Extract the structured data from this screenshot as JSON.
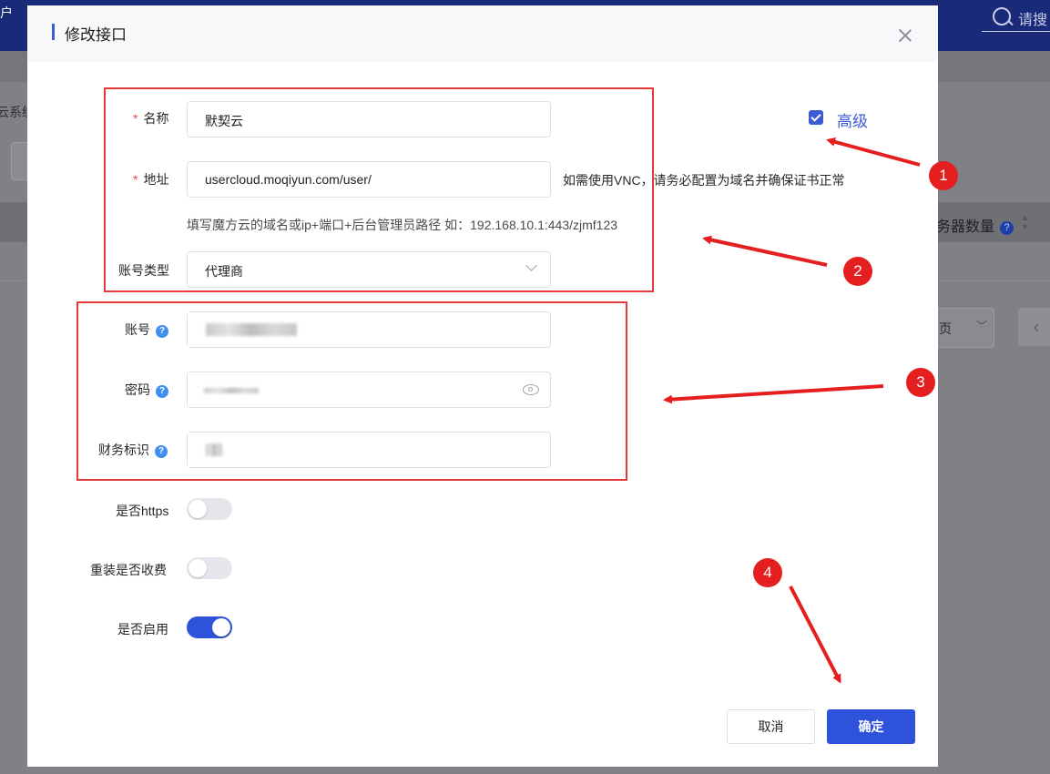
{
  "background": {
    "corner_text": "户",
    "search_placeholder": "请搜",
    "left_label": "云系统",
    "server_count_header": "务器数量",
    "server_count_help": "?",
    "page_selector": "页",
    "prev_glyph": "‹"
  },
  "dialog": {
    "title": "修改接口",
    "advanced_label": "高级",
    "advanced_checked": true,
    "fields": {
      "name": {
        "label": "名称",
        "required": true,
        "value": "默契云"
      },
      "address": {
        "label": "地址",
        "required": true,
        "value": "usercloud.moqiyun.com/user/",
        "side_hint": "如需使用VNC，请务必配置为域名并确保证书正常",
        "hint": "填写魔方云的域名或ip+端口+后台管理员路径 如：192.168.10.1:443/zjmf123"
      },
      "account_type": {
        "label": "账号类型",
        "value": "代理商"
      },
      "account": {
        "label": "账号"
      },
      "password": {
        "label": "密码"
      },
      "finance_id": {
        "label": "财务标识"
      }
    },
    "toggles": {
      "https": {
        "label": "是否https",
        "on": false
      },
      "reinstall_fee": {
        "label": "重装是否收费",
        "on": false
      },
      "enabled": {
        "label": "是否启用",
        "on": true
      }
    },
    "buttons": {
      "cancel": "取消",
      "confirm": "确定"
    }
  },
  "annotations": {
    "badges": [
      "1",
      "2",
      "3",
      "4"
    ],
    "color": "#e51f1f"
  }
}
